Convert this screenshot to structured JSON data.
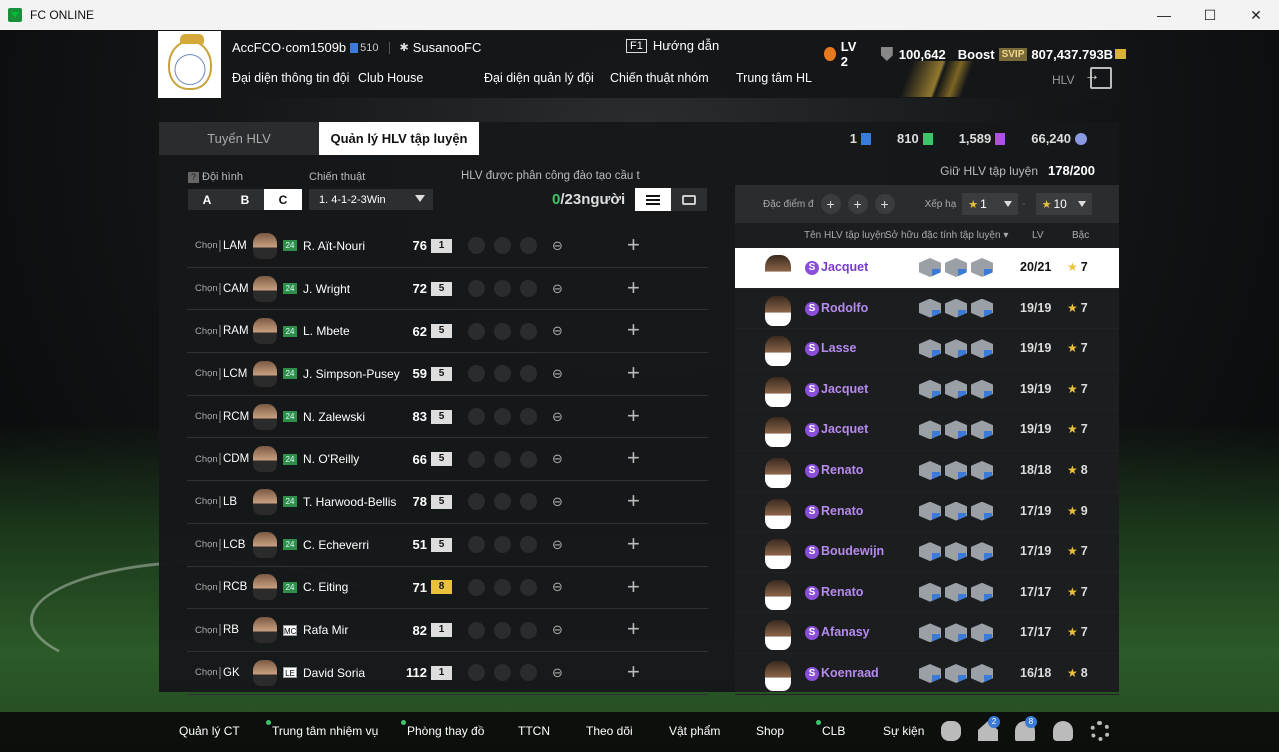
{
  "window": {
    "title": "FC ONLINE",
    "controls": [
      "—",
      "☐",
      "✕"
    ]
  },
  "header": {
    "account": "AccFCO·com1509b",
    "club_level": "510",
    "coach_name": "SusanooFC",
    "guide_key": "F1",
    "guide_label": "Hướng dẫn",
    "level": "LV 2",
    "trophy": "100,642",
    "boost_label": "Boost",
    "svip": "SVIP",
    "bp": "807,437.793B",
    "hlv": "HLV",
    "nav": [
      "Đại diện thông tin đội",
      "Club House",
      "Đại diện quản lý đội",
      "Chiến thuật nhóm",
      "Trung tâm HL"
    ]
  },
  "tabs": [
    "Tuyển HLV",
    "Quản lý HLV tập luyện"
  ],
  "currency": [
    {
      "value": "1",
      "color": "#3a7ad8"
    },
    {
      "value": "810",
      "color": "#3ec46a"
    },
    {
      "value": "1,589",
      "color": "#b050e0"
    },
    {
      "value": "66,240",
      "color": "#8a9ae0"
    }
  ],
  "keep": {
    "label": "Giữ HLV tập luyện",
    "value": "178/200"
  },
  "left": {
    "formation_label": "Đội hình",
    "formation_options": [
      "A",
      "B",
      "C"
    ],
    "tactic_label": "Chiến thuật",
    "tactic_value": "1. 4-1-2-3Win",
    "assign_label": "HLV được phân công đào tạo cầu t",
    "assign_count_green": "0",
    "assign_count_rest": "/23người",
    "choose_label": "Chọn",
    "players": [
      {
        "pos": "LAM",
        "season": "24",
        "name": "R. Aït-Nouri",
        "ovr": "76",
        "lvl": "1"
      },
      {
        "pos": "CAM",
        "season": "24",
        "name": "J. Wright",
        "ovr": "72",
        "lvl": "5"
      },
      {
        "pos": "RAM",
        "season": "24",
        "name": "L. Mbete",
        "ovr": "62",
        "lvl": "5"
      },
      {
        "pos": "LCM",
        "season": "24",
        "name": "J. Simpson-Pusey",
        "ovr": "59",
        "lvl": "5"
      },
      {
        "pos": "RCM",
        "season": "24",
        "name": "N. Zalewski",
        "ovr": "83",
        "lvl": "5"
      },
      {
        "pos": "CDM",
        "season": "24",
        "name": "N. O'Reilly",
        "ovr": "66",
        "lvl": "5"
      },
      {
        "pos": "LB",
        "season": "24",
        "name": "T. Harwood-Bellis",
        "ovr": "78",
        "lvl": "5"
      },
      {
        "pos": "LCB",
        "season": "24",
        "name": "C. Echeverri",
        "ovr": "51",
        "lvl": "5"
      },
      {
        "pos": "RCB",
        "season": "24",
        "name": "C. Eiting",
        "ovr": "71",
        "lvl": "8"
      },
      {
        "pos": "RB",
        "season": "MC",
        "name": "Rafa Mir",
        "ovr": "82",
        "lvl": "1"
      },
      {
        "pos": "GK",
        "season": "LE",
        "name": "David Soria",
        "ovr": "112",
        "lvl": "1"
      }
    ]
  },
  "right": {
    "filter_trait_label": "Đặc điểm đ",
    "sort_label": "Xếp hạ",
    "sort_from": "1",
    "sort_to": "10",
    "col_name": "Tên HLV tập luyện",
    "col_traits": "Sở hữu đặc tính tập luyện ▾",
    "col_lv": "LV",
    "col_rank": "Bậc",
    "coaches": [
      {
        "name": "Jacquet",
        "lv": "20/21",
        "rank": "7"
      },
      {
        "name": "Rodolfo",
        "lv": "19/19",
        "rank": "7"
      },
      {
        "name": "Lasse",
        "lv": "19/19",
        "rank": "7"
      },
      {
        "name": "Jacquet",
        "lv": "19/19",
        "rank": "7"
      },
      {
        "name": "Jacquet",
        "lv": "19/19",
        "rank": "7"
      },
      {
        "name": "Renato",
        "lv": "18/18",
        "rank": "8"
      },
      {
        "name": "Renato",
        "lv": "17/19",
        "rank": "9"
      },
      {
        "name": "Boudewijn",
        "lv": "17/19",
        "rank": "7"
      },
      {
        "name": "Renato",
        "lv": "17/17",
        "rank": "7"
      },
      {
        "name": "Afanasy",
        "lv": "17/17",
        "rank": "7"
      },
      {
        "name": "Koenraad",
        "lv": "16/18",
        "rank": "8"
      }
    ]
  },
  "bottom": {
    "items": [
      "Quản lý CT",
      "Trung tâm nhiệm vụ",
      "Phòng thay đồ",
      "TTCN",
      "Theo dõi",
      "Vật phẩm",
      "Shop",
      "CLB",
      "Sự kiện"
    ],
    "badges": {
      "home": "2",
      "bell": "8"
    }
  }
}
